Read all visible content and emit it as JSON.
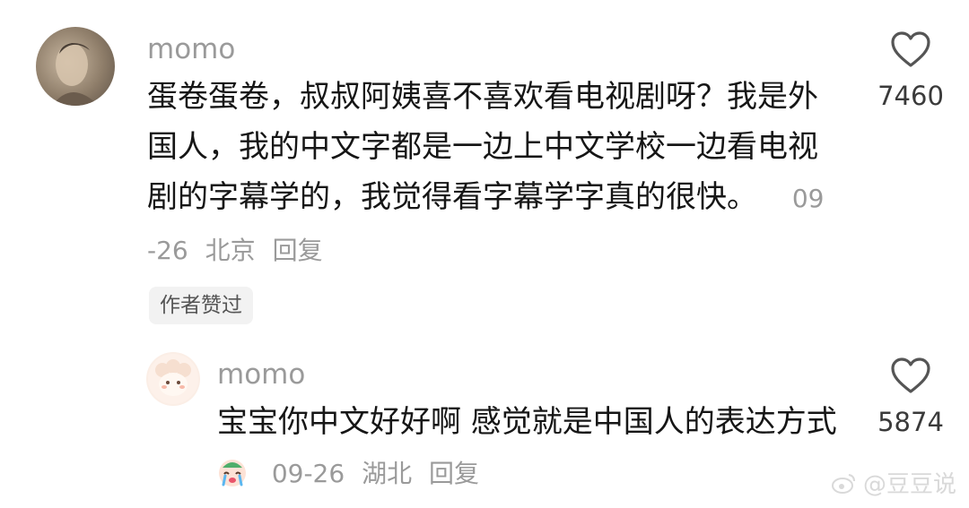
{
  "comments": [
    {
      "username": "momo",
      "text": "蛋卷蛋卷，叔叔阿姨喜不喜欢看电视剧呀？我是外国人，我的中文字都是一边上中文学校一边看电视剧的字幕学的，我觉得看字幕学字真的很快。",
      "date": "09-26",
      "location": "北京",
      "reply_label": "回复",
      "likes": "7460",
      "badge": "作者赞过"
    },
    {
      "username": "momo",
      "text": "宝宝你中文好好啊 感觉就是中国人的表达方式",
      "date": "09-26",
      "location": "湖北",
      "reply_label": "回复",
      "likes": "5874",
      "emoji": "crying-face"
    }
  ],
  "watermark": "@豆豆说",
  "colors": {
    "username": "#9a9a9a",
    "text": "#161616",
    "meta": "#9a9a9a",
    "badge_bg": "#f2f2f2"
  }
}
